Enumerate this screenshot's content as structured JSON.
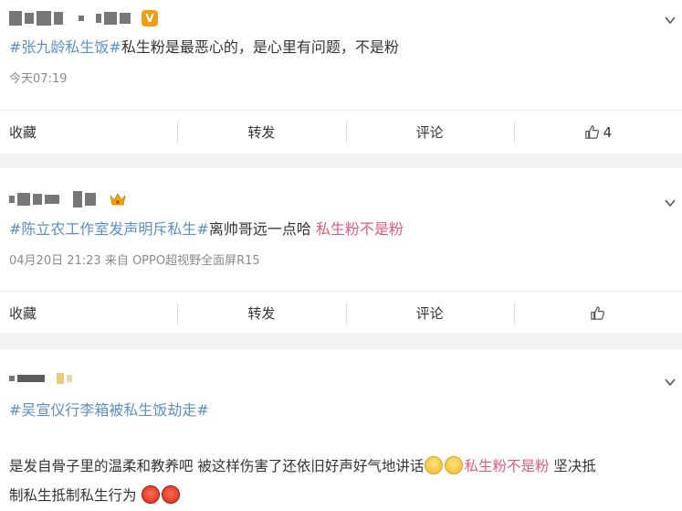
{
  "posts": [
    {
      "topic": "#张九龄私生饭#",
      "text": "私生粉是最恶心的，是心里有问题，不是粉",
      "meta": "今天07:19",
      "actions": {
        "favorite": "收藏",
        "repost": "转发",
        "comment": "评论",
        "like_count": "4"
      }
    },
    {
      "topic": "#陈立农工作室发声明斥私生#",
      "text": "离帅哥远一点哈 ",
      "highlight": "私生粉不是粉",
      "meta": "04月20日 21:23 来自 OPPO超视野全面屏R15",
      "actions": {
        "favorite": "收藏",
        "repost": "转发",
        "comment": "评论",
        "like_count": ""
      }
    },
    {
      "topic": "#吴宣仪行李箱被私生饭劫走#",
      "line1_pre": "是发自骨子里的温柔和教养吧 被这样伤害了还依旧好声好气地讲话",
      "line1_highlight": "私生粉不是粉",
      "line1_post": " 坚决抵",
      "line2": "制私生抵制私生行为"
    }
  ],
  "colors": {
    "topic": "#5b8fc7",
    "highlight": "#e05a7a",
    "badge": "#f39c12"
  },
  "icons": [
    "verified-v-icon",
    "crown-icon",
    "chevron-down-icon",
    "thumbs-up-icon",
    "sad-emoji-icon",
    "angry-emoji-icon"
  ]
}
